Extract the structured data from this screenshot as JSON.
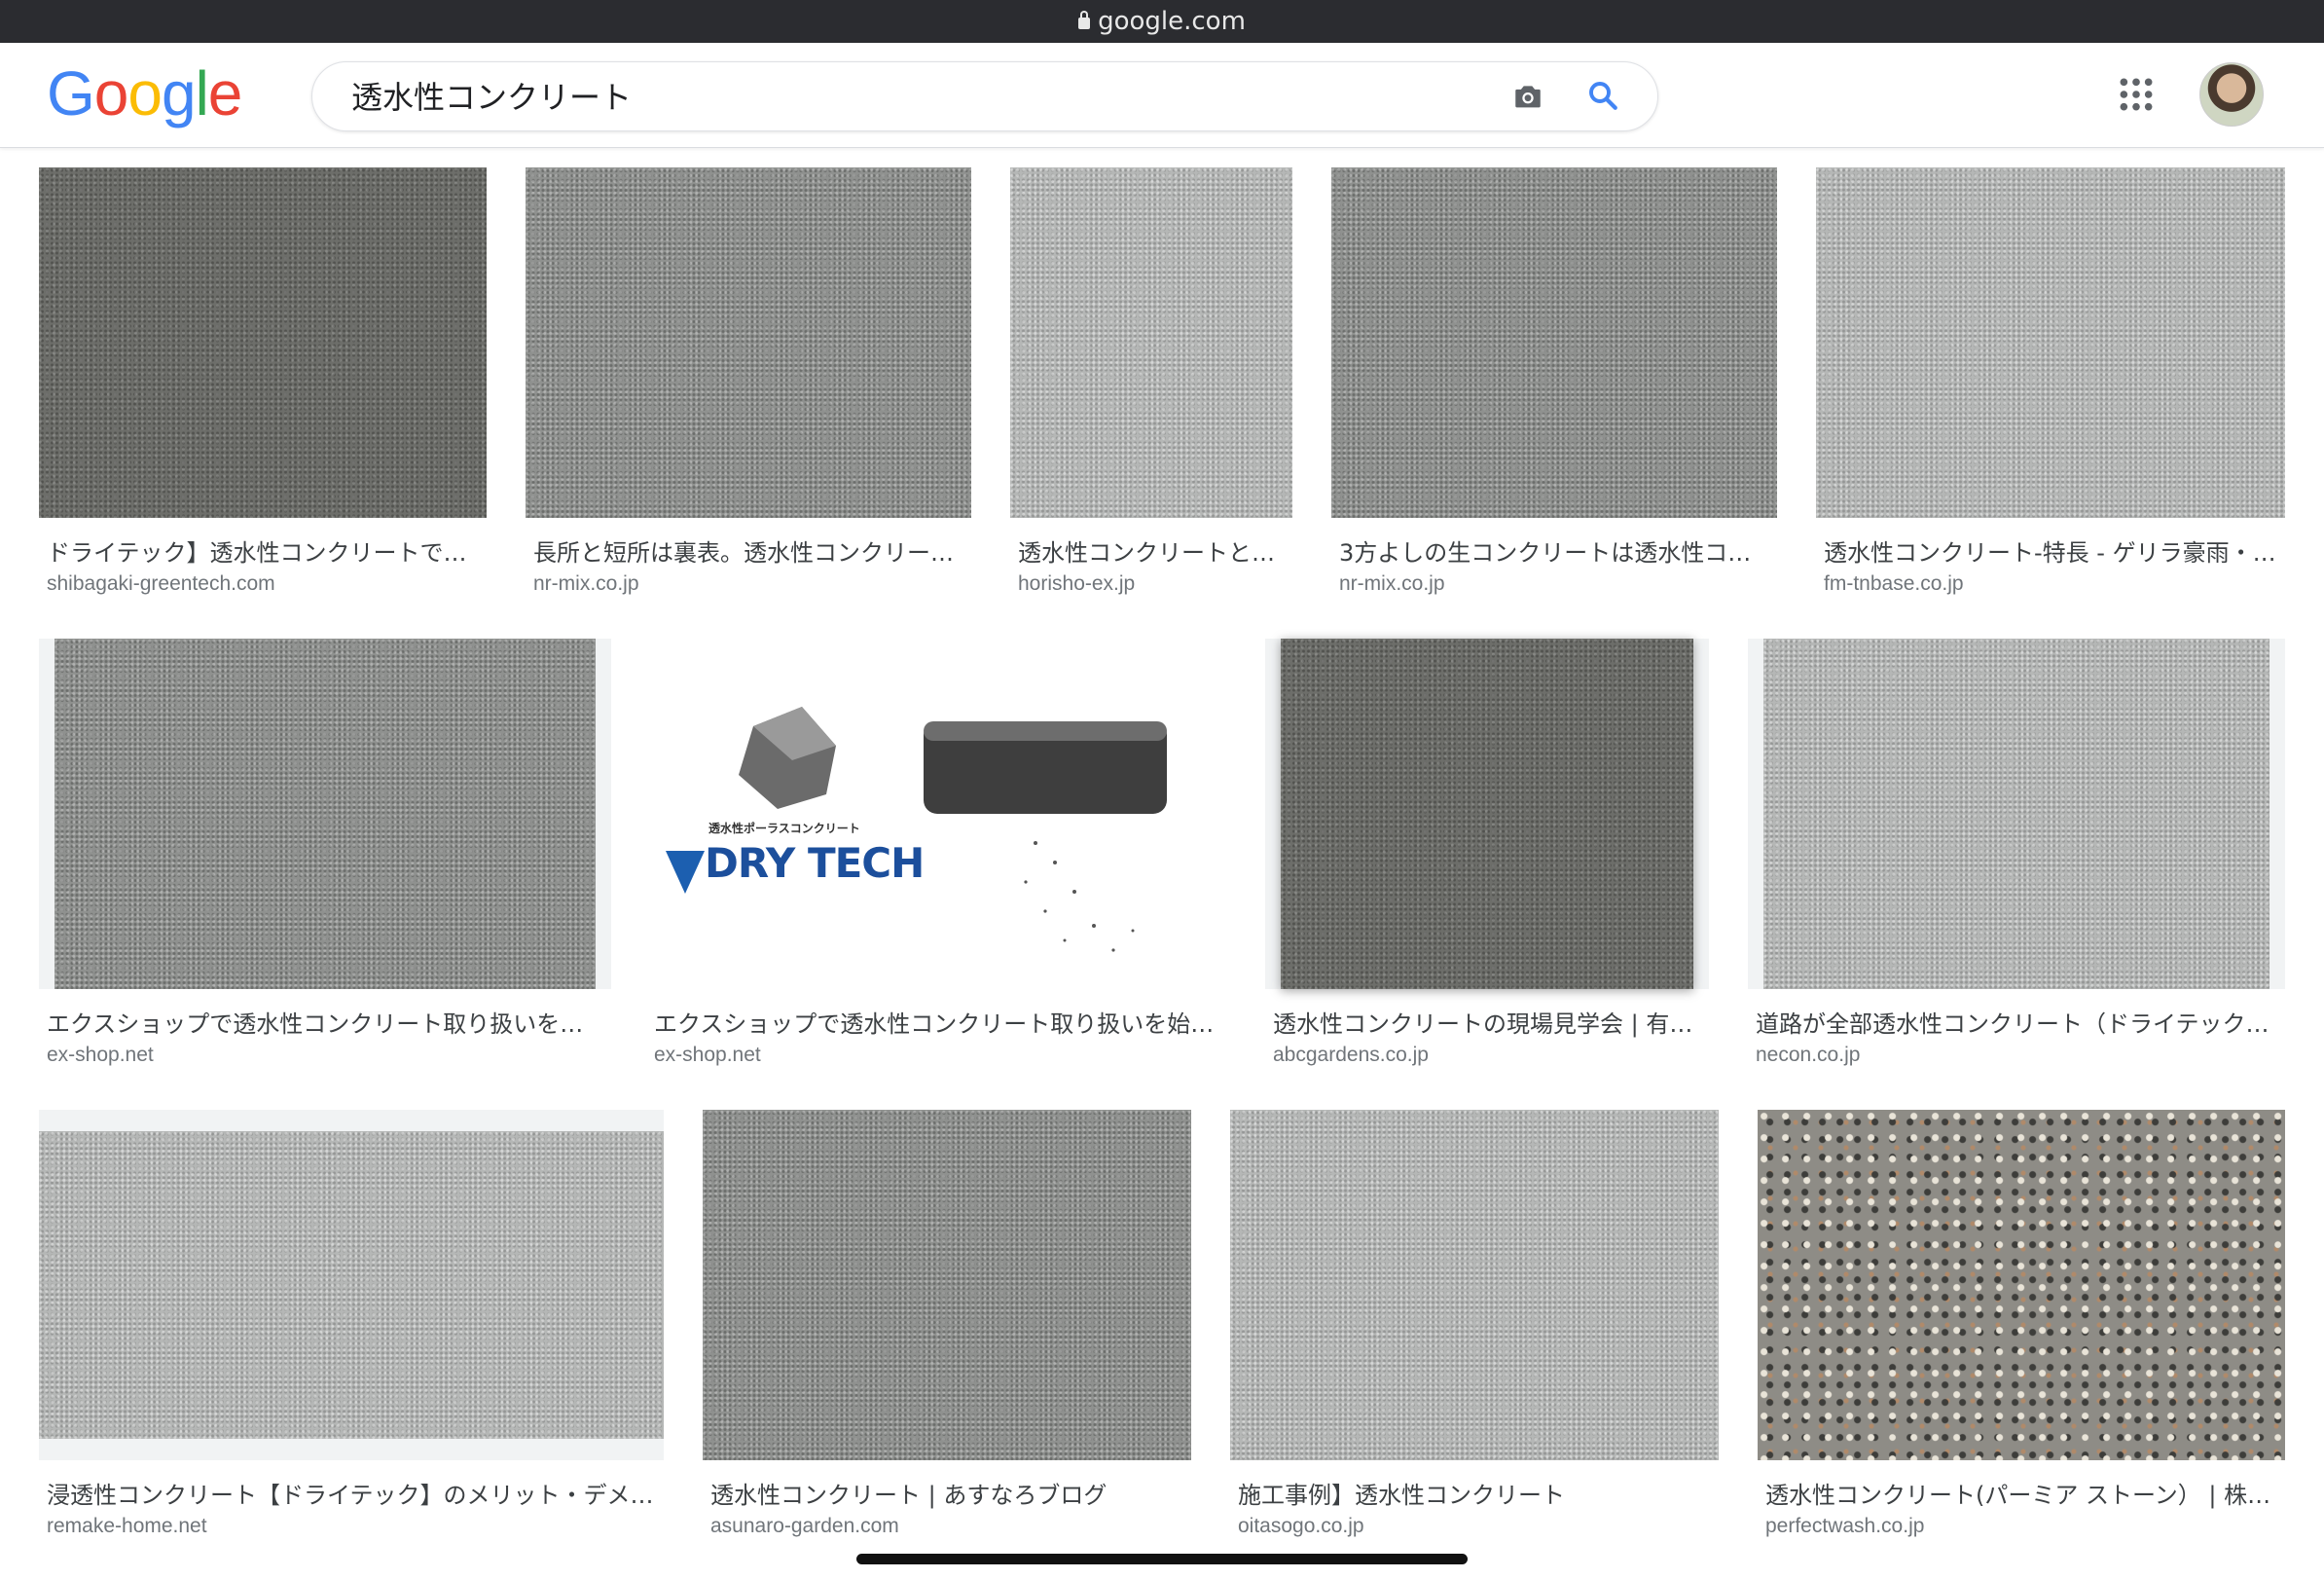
{
  "browser": {
    "url": "google.com"
  },
  "header": {
    "logo": [
      "G",
      "o",
      "o",
      "g",
      "l",
      "e"
    ],
    "logo_colors": [
      "#4285F4",
      "#EA4335",
      "#FBBC05",
      "#4285F4",
      "#34A853",
      "#EA4335"
    ],
    "search_query": "透水性コンクリート",
    "icons": [
      "camera-icon",
      "search-icon",
      "apps-grid-icon",
      "avatar"
    ]
  },
  "results": [
    {
      "caption": "ドライテック】透水性コンクリートで…",
      "source": "shibagaki-greentech.com",
      "texture": "gravel-dark"
    },
    {
      "caption": "長所と短所は裏表。透水性コンクリー…",
      "source": "nr-mix.co.jp",
      "texture": "gravel-mid"
    },
    {
      "caption": "透水性コンクリートと…",
      "source": "horisho-ex.jp",
      "texture": "gravel-light"
    },
    {
      "caption": "3方よしの生コンクリートは透水性コ…",
      "source": "nr-mix.co.jp",
      "texture": "gravel-mid"
    },
    {
      "caption": "透水性コンクリート-特長 - ゲリラ豪雨・…",
      "source": "fm-tnbase.co.jp",
      "texture": "gravel-light"
    },
    {
      "caption": "エクスショップで透水性コンクリート取り扱いを…",
      "source": "ex-shop.net",
      "texture": "gravel-mid"
    },
    {
      "caption": "エクスショップで透水性コンクリート取り扱いを始…",
      "source": "ex-shop.net",
      "texture": "drytech",
      "image_text": [
        "透水性ポーラスコンクリート",
        "DRY TECH"
      ]
    },
    {
      "caption": "透水性コンクリートの現場見学会 | 有…",
      "source": "abcgardens.co.jp",
      "texture": "gravel-dark"
    },
    {
      "caption": "道路が全部透水性コンクリート（ドライテック…",
      "source": "necon.co.jp",
      "texture": "gravel-light"
    },
    {
      "caption": "浸透性コンクリート【ドライテック】のメリット・デメ…",
      "source": "remake-home.net",
      "texture": "gravel-light"
    },
    {
      "caption": "透水性コンクリート | あすなろブログ",
      "source": "asunaro-garden.com",
      "texture": "gravel-mid"
    },
    {
      "caption": "施工事例】透水性コンクリート",
      "source": "oitasogo.co.jp",
      "texture": "gravel-light"
    },
    {
      "caption": "透水性コンクリート(パーミア ストーン） | 株…",
      "source": "perfectwash.co.jp",
      "texture": "terrazzo"
    }
  ]
}
